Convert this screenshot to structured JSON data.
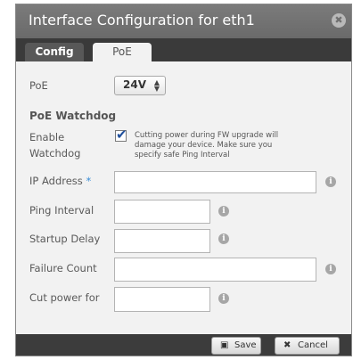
{
  "dialog": {
    "title": "Interface Configuration for eth1",
    "close_glyph": "✖"
  },
  "tabs": [
    {
      "label": "Config",
      "active": false
    },
    {
      "label": "PoE",
      "active": true
    }
  ],
  "poe": {
    "label": "PoE",
    "selected": "24V",
    "arrow_glyph": "▲▼"
  },
  "watchdog": {
    "title": "PoE Watchdog",
    "enable_label_1": "Enable",
    "enable_label_2": "Watchdog",
    "enable_checked": true,
    "note_lines": [
      "Cutting power during FW upgrade will",
      "damage your device. Make sure you",
      "specify safe Ping Interval"
    ]
  },
  "fields": {
    "ip_address": {
      "label": "IP Address",
      "required_mark": "*",
      "value": ""
    },
    "ping_interval": {
      "label": "Ping Interval",
      "value": ""
    },
    "startup_delay": {
      "label": "Startup Delay",
      "value": ""
    },
    "failure_count": {
      "label": "Failure Count",
      "value": ""
    },
    "cut_power_for": {
      "label": "Cut power for",
      "value": ""
    }
  },
  "info_glyph": "i",
  "footer": {
    "save_label": "Save",
    "save_icon": "save-icon",
    "cancel_label": "Cancel",
    "cancel_icon": "x-icon"
  },
  "colors": {
    "titlebar": "#6f6f6f",
    "tabbar": "#3a3a3a",
    "required_mark": "#3b8ed8",
    "checkmark": "#1f4f9c"
  }
}
